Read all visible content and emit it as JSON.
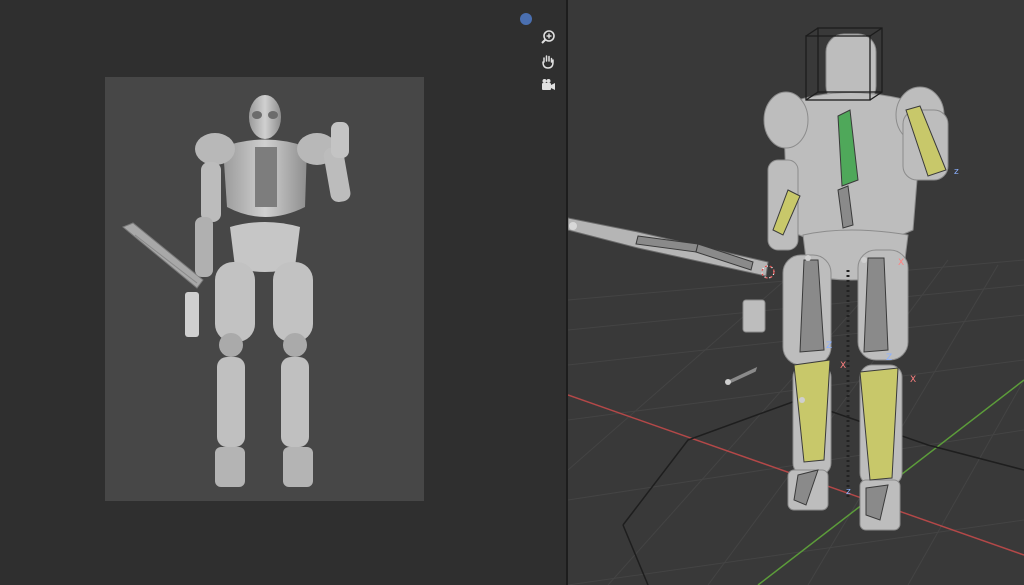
{
  "colors": {
    "left_background": "#2f2f2f",
    "render_background": "#474747",
    "viewport_background": "#393939",
    "grid_line": "#444444",
    "axis_x": "#b34848",
    "axis_y": "#5c9c3a",
    "bone_gray": "#8a8a8a",
    "bone_yellow": "#c8c86a",
    "bone_green": "#4fa85a",
    "gizmo_blue": "#4a6fb0"
  },
  "navigation": {
    "orientation_dot_icon": "circle-dot-icon",
    "zoom_icon": "magnifier-plus-icon",
    "pan_icon": "hand-icon",
    "camera_icon": "camera-icon"
  },
  "viewport": {
    "axis_labels": [
      "z",
      "X",
      "Z",
      "X",
      "Z",
      "X",
      "z"
    ]
  }
}
